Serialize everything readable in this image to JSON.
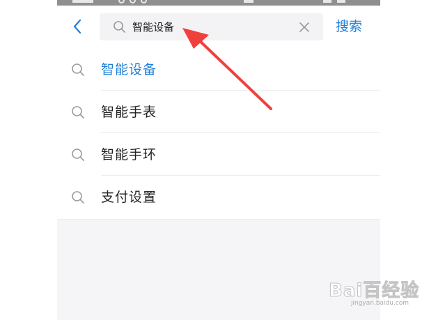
{
  "search": {
    "query": "智能设备",
    "submit_label": "搜索"
  },
  "suggestions": [
    {
      "label": "智能设备",
      "active": true
    },
    {
      "label": "智能手表",
      "active": false
    },
    {
      "label": "智能手环",
      "active": false
    },
    {
      "label": "支付设置",
      "active": false
    }
  ],
  "annotation": {
    "color": "#f0403c"
  },
  "watermark": {
    "logo_text": "Bai百经验",
    "url": "jingyan.baidu.com"
  },
  "colors": {
    "accent": "#1f7fd6",
    "text": "#222222",
    "icon_gray": "#9a9a9a",
    "search_bg": "#f3f3f5",
    "page_bg": "#f5f5f8"
  },
  "icons": {
    "back": "chevron-left-icon",
    "search": "search-icon",
    "clear": "close-icon",
    "suggestion": "search-icon"
  }
}
